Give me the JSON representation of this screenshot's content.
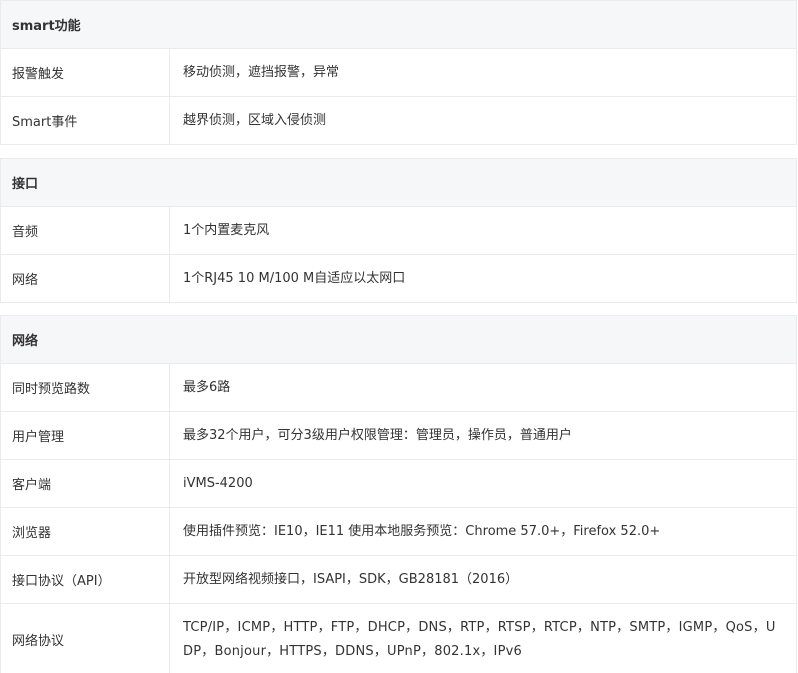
{
  "sections": [
    {
      "title": "smart功能",
      "rows": [
        {
          "label": "报警触发",
          "value": "移动侦测，遮挡报警，异常"
        },
        {
          "label": "Smart事件",
          "value": "越界侦测，区域入侵侦测"
        }
      ]
    },
    {
      "title": "接口",
      "rows": [
        {
          "label": "音频",
          "value": "1个内置麦克风"
        },
        {
          "label": "网络",
          "value": "1个RJ45 10 M/100 M自适应以太网口"
        }
      ]
    },
    {
      "title": "网络",
      "rows": [
        {
          "label": "同时预览路数",
          "value": "最多6路"
        },
        {
          "label": "用户管理",
          "value": "最多32个用户，可分3级用户权限管理：管理员，操作员，普通用户"
        },
        {
          "label": "客户端",
          "value": "iVMS-4200"
        },
        {
          "label": "浏览器",
          "value": "使用插件预览：IE10，IE11 使用本地服务预览：Chrome 57.0+，Firefox 52.0+"
        },
        {
          "label": "接口协议（API）",
          "value": "开放型网络视频接口，ISAPI，SDK，GB28181（2016）"
        },
        {
          "label": "网络协议",
          "value": "TCP/IP，ICMP，HTTP，FTP，DHCP，DNS，RTP，RTSP，RTCP，NTP，SMTP，IGMP，QoS，UDP，Bonjour，HTTPS，DDNS，UPnP，802.1x，IPv6"
        }
      ]
    }
  ]
}
